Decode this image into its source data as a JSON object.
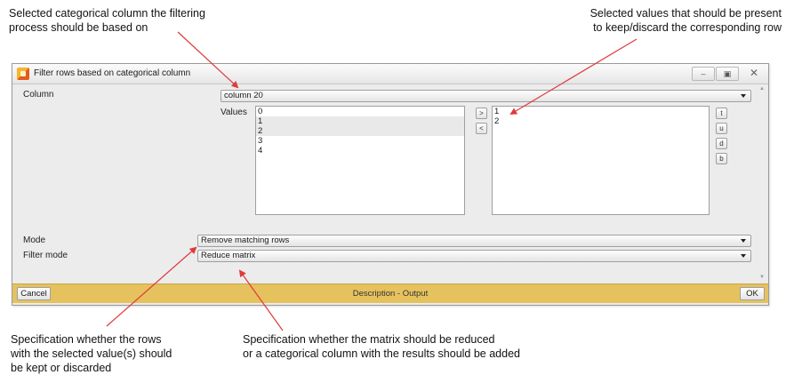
{
  "callouts": {
    "top_left": "Selected categorical column the filtering\nprocess should be based on",
    "top_right": "Selected values that should be present\nto keep/discard the corresponding row",
    "bottom_left": "Specification whether the rows\nwith the selected value(s) should\nbe kept or discarded",
    "bottom_center": "Specification whether the matrix should be reduced\nor a categorical column with the results should be added"
  },
  "window": {
    "title": "Filter rows based on categorical column",
    "min_glyph": "–",
    "max_glyph": "▣",
    "close_glyph": "✕"
  },
  "form": {
    "column_label": "Column",
    "column_value": "column 20",
    "values_label": "Values",
    "available_values": [
      "0",
      "1",
      "2",
      "3",
      "4"
    ],
    "selected_available_indices": [
      1,
      2
    ],
    "add_button": ">",
    "remove_button": "<",
    "selected_values": [
      "1",
      "2"
    ],
    "side_buttons": [
      "t",
      "u",
      "d",
      "b"
    ],
    "mode_label": "Mode",
    "mode_value": "Remove matching rows",
    "filter_mode_label": "Filter mode",
    "filter_mode_value": "Reduce matrix"
  },
  "footer": {
    "cancel": "Cancel",
    "center": "Description - Output",
    "ok": "OK"
  },
  "colors": {
    "arrow": "#e03a3a",
    "footer_bar": "#e6c25e"
  }
}
